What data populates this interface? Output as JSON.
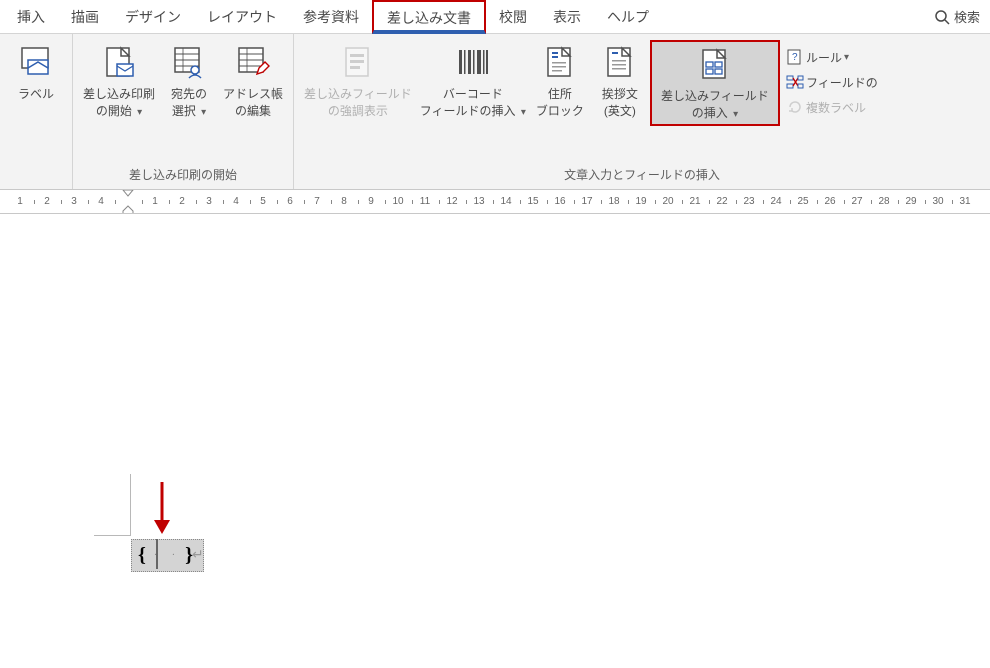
{
  "tabs": [
    "挿入",
    "描画",
    "デザイン",
    "レイアウト",
    "参考資料",
    "差し込み文書",
    "校閲",
    "表示",
    "ヘルプ"
  ],
  "active_tab_index": 5,
  "search_label": "検索",
  "groups": {
    "create": {
      "label_btn": "ラベル"
    },
    "start": {
      "mailmerge_start": "差し込み印刷\nの開始",
      "recipients": "宛先の\n選択",
      "addressbook": "アドレス帳\nの編集",
      "group_label": "差し込み印刷の開始"
    },
    "write": {
      "highlight": "差し込みフィールド\nの強調表示",
      "barcode": "バーコード\nフィールドの挿入",
      "address": "住所\nブロック",
      "greeting": "挨拶文\n(英文)",
      "insert_field": "差し込みフィールド\nの挿入",
      "group_label": "文章入力とフィールドの挿入"
    },
    "side": {
      "rules": "ルール",
      "fieldmap": "フィールドの",
      "labels": "複数ラベル"
    }
  },
  "ruler": {
    "left_nums": [
      "4",
      "3",
      "2",
      "1"
    ],
    "right_nums": [
      "1",
      "2",
      "3",
      "4",
      "5",
      "6",
      "7",
      "8",
      "9",
      "10",
      "11",
      "12",
      "13",
      "14",
      "15",
      "16",
      "17",
      "18",
      "19",
      "20",
      "21",
      "22",
      "23",
      "24",
      "25",
      "26",
      "27",
      "28",
      "29",
      "30",
      "31"
    ]
  },
  "field_code": "{  ·  ·  }",
  "return_mark": "↵"
}
